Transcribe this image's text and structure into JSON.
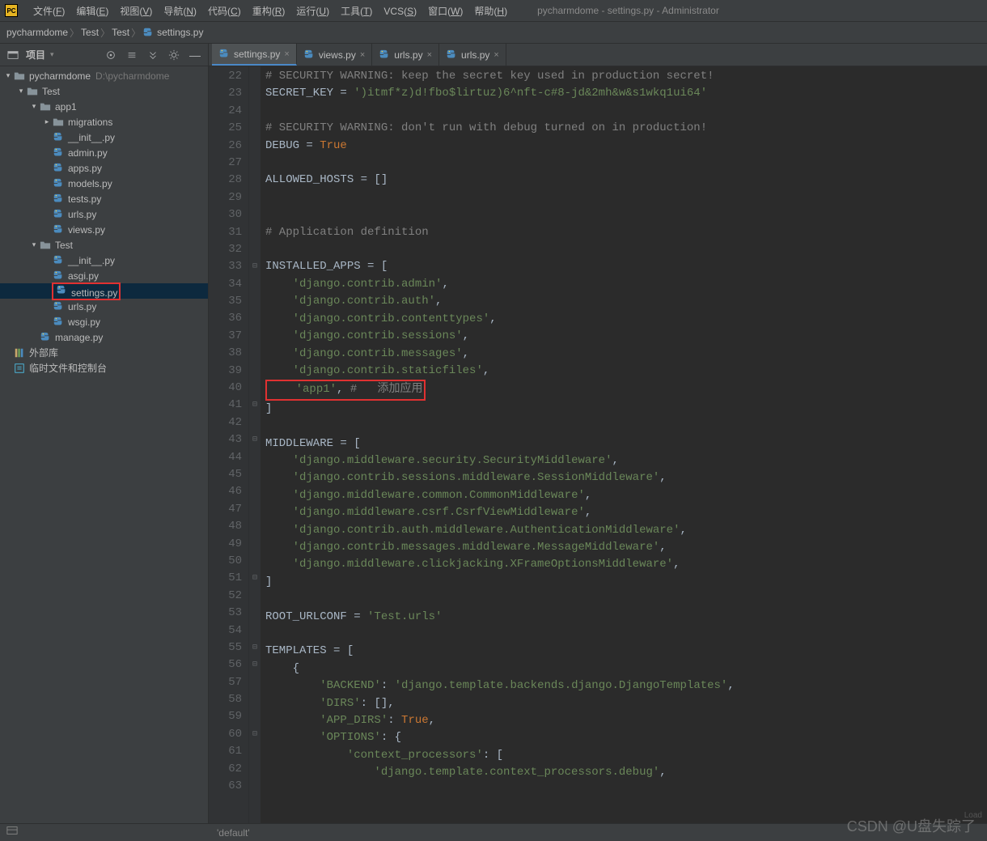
{
  "app_icon_text": "PC",
  "title": "pycharmdome - settings.py - Administrator",
  "menu": [
    {
      "label": "文件",
      "u": "F"
    },
    {
      "label": "编辑",
      "u": "E"
    },
    {
      "label": "视图",
      "u": "V"
    },
    {
      "label": "导航",
      "u": "N"
    },
    {
      "label": "代码",
      "u": "C"
    },
    {
      "label": "重构",
      "u": "R"
    },
    {
      "label": "运行",
      "u": "U"
    },
    {
      "label": "工具",
      "u": "T"
    },
    {
      "label": "VCS",
      "u": "S"
    },
    {
      "label": "窗口",
      "u": "W"
    },
    {
      "label": "帮助",
      "u": "H"
    }
  ],
  "breadcrumbs": [
    "pycharmdome",
    "Test",
    "Test",
    "settings.py"
  ],
  "toolwindow_title": "项目",
  "tree": [
    {
      "indent": 0,
      "arrow": "▾",
      "icon": "folder",
      "label": "pycharmdome",
      "hint": "D:\\pycharmdome"
    },
    {
      "indent": 1,
      "arrow": "▾",
      "icon": "folder",
      "label": "Test",
      "hint": ""
    },
    {
      "indent": 2,
      "arrow": "▾",
      "icon": "folder",
      "label": "app1",
      "hint": ""
    },
    {
      "indent": 3,
      "arrow": "▸",
      "icon": "folder",
      "label": "migrations",
      "hint": ""
    },
    {
      "indent": 3,
      "arrow": "",
      "icon": "py",
      "label": "__init__.py",
      "hint": ""
    },
    {
      "indent": 3,
      "arrow": "",
      "icon": "py",
      "label": "admin.py",
      "hint": ""
    },
    {
      "indent": 3,
      "arrow": "",
      "icon": "py",
      "label": "apps.py",
      "hint": ""
    },
    {
      "indent": 3,
      "arrow": "",
      "icon": "py",
      "label": "models.py",
      "hint": ""
    },
    {
      "indent": 3,
      "arrow": "",
      "icon": "py",
      "label": "tests.py",
      "hint": ""
    },
    {
      "indent": 3,
      "arrow": "",
      "icon": "py",
      "label": "urls.py",
      "hint": ""
    },
    {
      "indent": 3,
      "arrow": "",
      "icon": "py",
      "label": "views.py",
      "hint": ""
    },
    {
      "indent": 2,
      "arrow": "▾",
      "icon": "folder",
      "label": "Test",
      "hint": ""
    },
    {
      "indent": 3,
      "arrow": "",
      "icon": "py",
      "label": "__init__.py",
      "hint": ""
    },
    {
      "indent": 3,
      "arrow": "",
      "icon": "py",
      "label": "asgi.py",
      "hint": ""
    },
    {
      "indent": 3,
      "arrow": "",
      "icon": "py",
      "label": "settings.py",
      "hint": "",
      "selected": true,
      "boxed": true
    },
    {
      "indent": 3,
      "arrow": "",
      "icon": "py",
      "label": "urls.py",
      "hint": ""
    },
    {
      "indent": 3,
      "arrow": "",
      "icon": "py",
      "label": "wsgi.py",
      "hint": ""
    },
    {
      "indent": 2,
      "arrow": "",
      "icon": "py",
      "label": "manage.py",
      "hint": ""
    },
    {
      "indent": 0,
      "arrow": "",
      "icon": "lib",
      "label": "外部库",
      "hint": ""
    },
    {
      "indent": 0,
      "arrow": "",
      "icon": "scratch",
      "label": "临时文件和控制台",
      "hint": ""
    }
  ],
  "tabs": [
    {
      "label": "settings.py",
      "active": true
    },
    {
      "label": "views.py",
      "active": false
    },
    {
      "label": "urls.py",
      "active": false
    },
    {
      "label": "urls.py",
      "active": false
    }
  ],
  "first_line_no": 22,
  "code": [
    {
      "t": "cm",
      "txt": "# SECURITY WARNING: keep the secret key used in production secret!"
    },
    {
      "spans": [
        {
          "t": "id",
          "txt": "SECRET_KEY = "
        },
        {
          "t": "str",
          "txt": "')itmf*z)d!fbo$lirtuz)6^nft-c#8-jd&2mh&w&s1wkq1ui64'"
        }
      ]
    },
    {
      "spans": []
    },
    {
      "t": "cm",
      "txt": "# SECURITY WARNING: don't run with debug turned on in production!"
    },
    {
      "spans": [
        {
          "t": "id",
          "txt": "DEBUG = "
        },
        {
          "t": "kw",
          "txt": "True"
        }
      ]
    },
    {
      "spans": []
    },
    {
      "spans": [
        {
          "t": "id",
          "txt": "ALLOWED_HOSTS = []"
        }
      ]
    },
    {
      "spans": []
    },
    {
      "spans": []
    },
    {
      "t": "cm",
      "txt": "# Application definition"
    },
    {
      "spans": []
    },
    {
      "spans": [
        {
          "t": "id",
          "txt": "INSTALLED_APPS = ["
        }
      ],
      "fold": "⊟"
    },
    {
      "spans": [
        {
          "t": "id",
          "txt": "    "
        },
        {
          "t": "str",
          "txt": "'django.contrib.admin'"
        },
        {
          "t": "id",
          "txt": ","
        }
      ]
    },
    {
      "spans": [
        {
          "t": "id",
          "txt": "    "
        },
        {
          "t": "str",
          "txt": "'django.contrib.auth'"
        },
        {
          "t": "id",
          "txt": ","
        }
      ]
    },
    {
      "spans": [
        {
          "t": "id",
          "txt": "    "
        },
        {
          "t": "str",
          "txt": "'django.contrib.contenttypes'"
        },
        {
          "t": "id",
          "txt": ","
        }
      ]
    },
    {
      "spans": [
        {
          "t": "id",
          "txt": "    "
        },
        {
          "t": "str",
          "txt": "'django.contrib.sessions'"
        },
        {
          "t": "id",
          "txt": ","
        }
      ]
    },
    {
      "spans": [
        {
          "t": "id",
          "txt": "    "
        },
        {
          "t": "str",
          "txt": "'django.contrib.messages'"
        },
        {
          "t": "id",
          "txt": ","
        }
      ]
    },
    {
      "spans": [
        {
          "t": "id",
          "txt": "    "
        },
        {
          "t": "str",
          "txt": "'django.contrib.staticfiles'"
        },
        {
          "t": "id",
          "txt": ","
        }
      ]
    },
    {
      "boxed": true,
      "spans": [
        {
          "t": "id",
          "txt": "    "
        },
        {
          "t": "str",
          "txt": "'app1'"
        },
        {
          "t": "id",
          "txt": ", "
        },
        {
          "t": "cm",
          "txt": "#   添加应用"
        }
      ]
    },
    {
      "spans": [
        {
          "t": "id",
          "txt": "]"
        }
      ],
      "fold": "⊟"
    },
    {
      "spans": []
    },
    {
      "spans": [
        {
          "t": "id",
          "txt": "MIDDLEWARE = ["
        }
      ],
      "fold": "⊟"
    },
    {
      "spans": [
        {
          "t": "id",
          "txt": "    "
        },
        {
          "t": "str",
          "txt": "'django.middleware.security.SecurityMiddleware'"
        },
        {
          "t": "id",
          "txt": ","
        }
      ]
    },
    {
      "spans": [
        {
          "t": "id",
          "txt": "    "
        },
        {
          "t": "str",
          "txt": "'django.contrib.sessions.middleware.SessionMiddleware'"
        },
        {
          "t": "id",
          "txt": ","
        }
      ]
    },
    {
      "spans": [
        {
          "t": "id",
          "txt": "    "
        },
        {
          "t": "str",
          "txt": "'django.middleware.common.CommonMiddleware'"
        },
        {
          "t": "id",
          "txt": ","
        }
      ]
    },
    {
      "spans": [
        {
          "t": "id",
          "txt": "    "
        },
        {
          "t": "str",
          "txt": "'django.middleware.csrf.CsrfViewMiddleware'"
        },
        {
          "t": "id",
          "txt": ","
        }
      ]
    },
    {
      "spans": [
        {
          "t": "id",
          "txt": "    "
        },
        {
          "t": "str",
          "txt": "'django.contrib.auth.middleware.AuthenticationMiddleware'"
        },
        {
          "t": "id",
          "txt": ","
        }
      ]
    },
    {
      "spans": [
        {
          "t": "id",
          "txt": "    "
        },
        {
          "t": "str",
          "txt": "'django.contrib.messages.middleware.MessageMiddleware'"
        },
        {
          "t": "id",
          "txt": ","
        }
      ]
    },
    {
      "spans": [
        {
          "t": "id",
          "txt": "    "
        },
        {
          "t": "str",
          "txt": "'django.middleware.clickjacking.XFrameOptionsMiddleware'"
        },
        {
          "t": "id",
          "txt": ","
        }
      ]
    },
    {
      "spans": [
        {
          "t": "id",
          "txt": "]"
        }
      ],
      "fold": "⊟"
    },
    {
      "spans": []
    },
    {
      "spans": [
        {
          "t": "id",
          "txt": "ROOT_URLCONF = "
        },
        {
          "t": "str",
          "txt": "'Test.urls'"
        }
      ]
    },
    {
      "spans": []
    },
    {
      "spans": [
        {
          "t": "id",
          "txt": "TEMPLATES = ["
        }
      ],
      "fold": "⊟"
    },
    {
      "spans": [
        {
          "t": "id",
          "txt": "    {"
        }
      ],
      "fold": "⊟"
    },
    {
      "spans": [
        {
          "t": "id",
          "txt": "        "
        },
        {
          "t": "str",
          "txt": "'BACKEND'"
        },
        {
          "t": "id",
          "txt": ": "
        },
        {
          "t": "str",
          "txt": "'django.template.backends.django.DjangoTemplates'"
        },
        {
          "t": "id",
          "txt": ","
        }
      ]
    },
    {
      "spans": [
        {
          "t": "id",
          "txt": "        "
        },
        {
          "t": "str",
          "txt": "'DIRS'"
        },
        {
          "t": "id",
          "txt": ": [],"
        }
      ]
    },
    {
      "spans": [
        {
          "t": "id",
          "txt": "        "
        },
        {
          "t": "str",
          "txt": "'APP_DIRS'"
        },
        {
          "t": "id",
          "txt": ": "
        },
        {
          "t": "kw",
          "txt": "True"
        },
        {
          "t": "id",
          "txt": ","
        }
      ]
    },
    {
      "spans": [
        {
          "t": "id",
          "txt": "        "
        },
        {
          "t": "str",
          "txt": "'OPTIONS'"
        },
        {
          "t": "id",
          "txt": ": {"
        }
      ],
      "fold": "⊟"
    },
    {
      "spans": [
        {
          "t": "id",
          "txt": "            "
        },
        {
          "t": "str",
          "txt": "'context_processors'"
        },
        {
          "t": "id",
          "txt": ": ["
        }
      ]
    },
    {
      "spans": [
        {
          "t": "id",
          "txt": "                "
        },
        {
          "t": "str",
          "txt": "'django.template.context_processors.debug'"
        },
        {
          "t": "id",
          "txt": ","
        }
      ]
    },
    {
      "spans": []
    }
  ],
  "crumb_bottom": "'default'",
  "load_hint": "Load",
  "watermark": "CSDN @U盘失踪了"
}
